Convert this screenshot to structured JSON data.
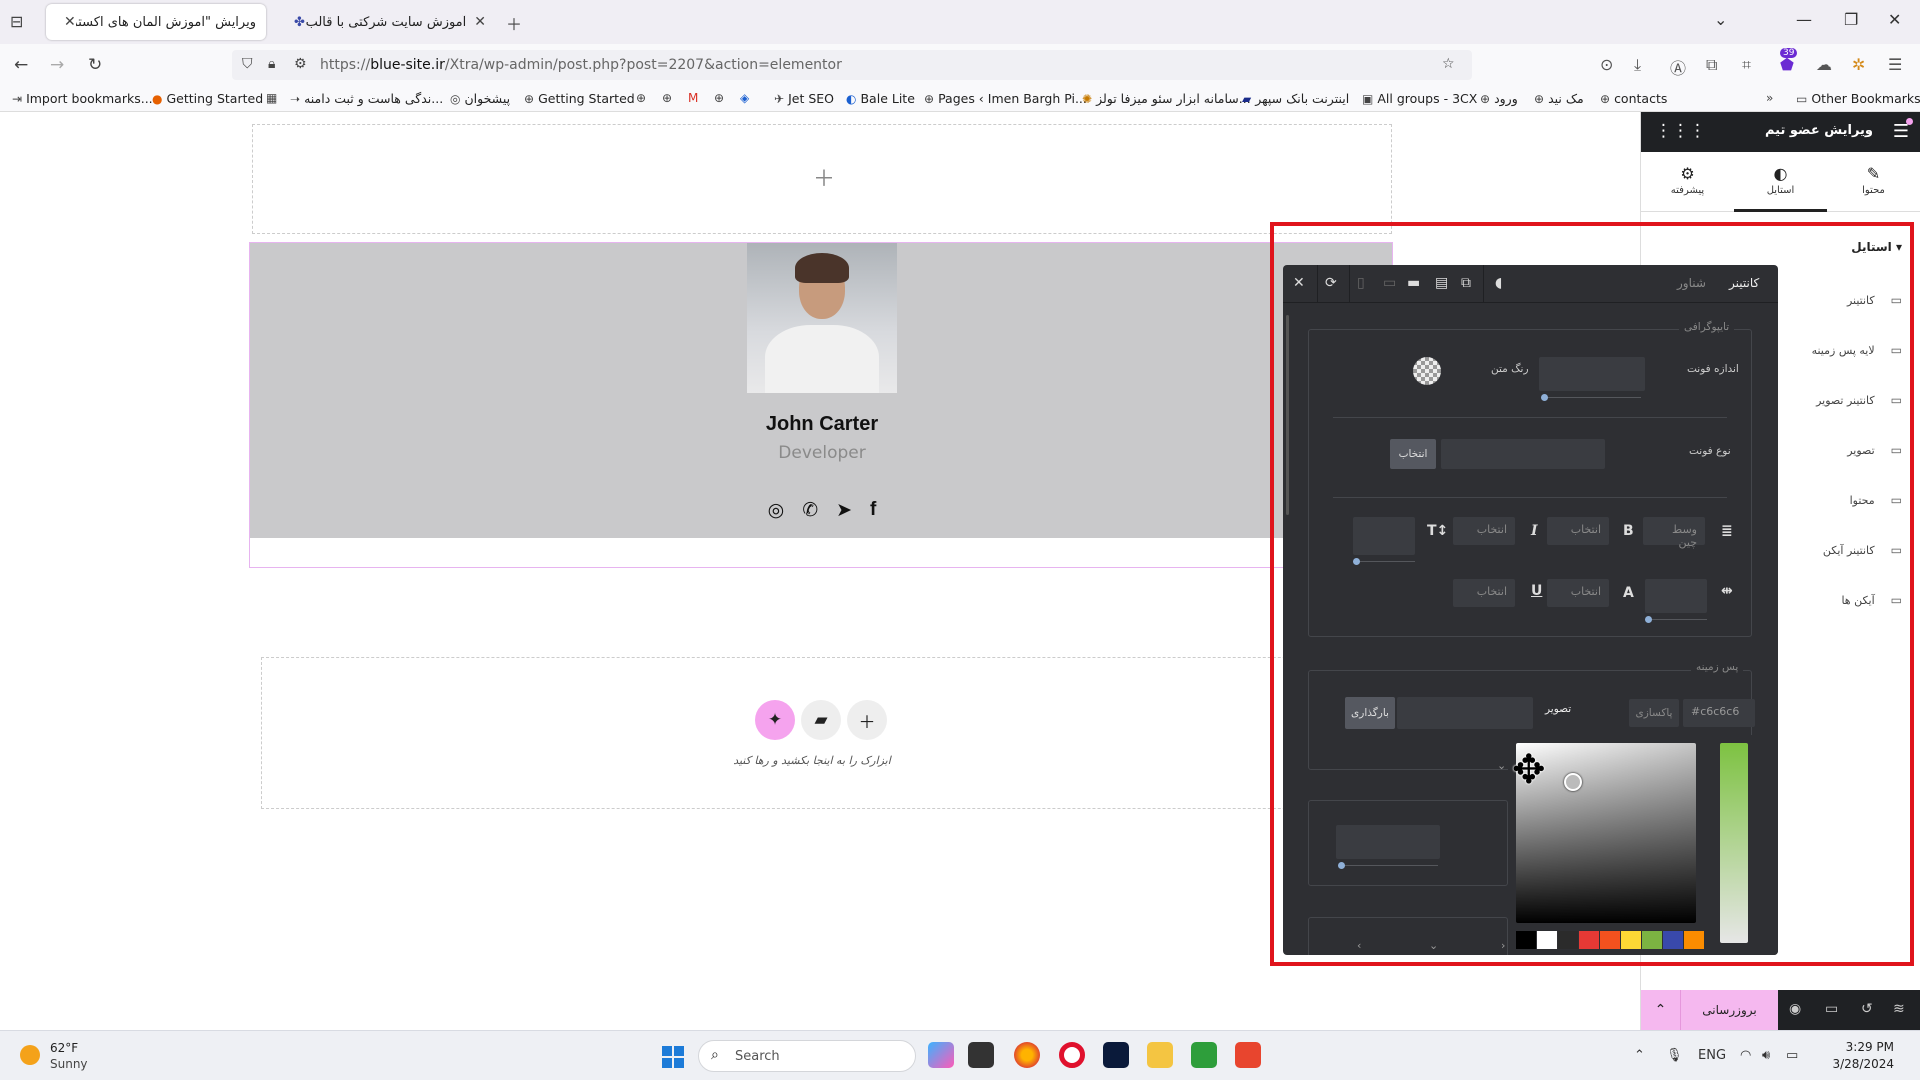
{
  "browser": {
    "tabs": [
      {
        "title": "ویرایش \"آموزش المان های اکسترا – ...",
        "active": true
      },
      {
        "title": "آموزش سایت شرکتی با قالب اکسـ...",
        "active": false
      }
    ],
    "url_prefix": "https://",
    "url_host": "blue-site.ir",
    "url_path": "/Xtra/wp-admin/post.php?post=2207&action=elementor",
    "extension_badge": "39"
  },
  "bookmarks": {
    "items": [
      "Import bookmarks...",
      "Getting Started",
      "...ندگی هاست و ثبت دامنه",
      "پیشخوان",
      "Getting Started",
      "Jet SEO",
      "Bale Lite",
      "Pages ‹ Imen Bargh Pi...",
      "...سامانه ابزار سئو میزفا تولز",
      "اینترنت بانک سپهر",
      "All groups - 3CX",
      "ورود",
      "مک نید",
      "contacts"
    ],
    "other": "Other Bookmarks"
  },
  "canvas": {
    "team": {
      "name": "John Carter",
      "role": "Developer"
    },
    "drop_hint": "ابزارک را به اینجا بکشید و رها کنید"
  },
  "popup": {
    "tabs": {
      "container": "کانتینر",
      "floating": "شناور"
    },
    "typography_legend": "تایپوگرافی",
    "font_size_label": "اندازه فونت",
    "text_color_label": "رنگ متن",
    "font_family_label": "نوع فونت",
    "choose_button": "انتخاب",
    "align_value": "وسط چین",
    "select_placeholder": "انتخاب",
    "background_legend": "پس زمینه",
    "image_label": "تصویر",
    "upload_button": "بارگذاری",
    "clear_button": "پاکسازی",
    "color_hex": "#c6c6c6",
    "swatches": [
      "#000000",
      "#ffffff",
      "#2b2b2b",
      "#e53935",
      "#f4511e",
      "#fdd835",
      "#7cb342",
      "#3949ab",
      "#fb8c00"
    ]
  },
  "panel": {
    "title": "ویرایش عضو تیم",
    "tabs": [
      {
        "label": "محتوا",
        "icon": "pencil-icon"
      },
      {
        "label": "استایل",
        "icon": "contrast-icon"
      },
      {
        "label": "پیشرفته",
        "icon": "gear-icon"
      }
    ],
    "section": "استایل",
    "items": [
      "کانتینر",
      "لایه پس زمینه",
      "کانتینر تصویر",
      "تصویر",
      "محتوا",
      "کانتینر آیکن",
      "آیکن ها"
    ],
    "publish": "بروزرسانی"
  },
  "taskbar": {
    "temp": "62°F",
    "weather": "Sunny",
    "search": "Search",
    "lang": "ENG",
    "time": "3:29 PM",
    "date": "3/28/2024"
  }
}
